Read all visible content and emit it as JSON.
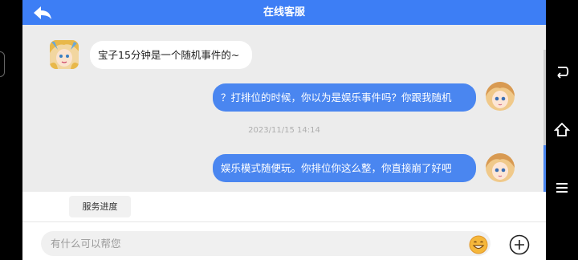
{
  "header": {
    "title": "在线客服"
  },
  "messages": {
    "incoming_1": "宝子15分钟是一个随机事件的~",
    "outgoing_1": "？打排位的时候，你以为是娱乐事件吗？你跟我随机",
    "timestamp": "2023/11/15 14:14",
    "outgoing_2": "娱乐模式随便玩。你排位你这么整，你直接崩了好吧"
  },
  "service_bar": {
    "chip_label": "服务进度"
  },
  "input_bar": {
    "placeholder": "有什么可以帮您"
  },
  "icons": {
    "back": "back-arrow-icon",
    "emoji": "smiley-icon",
    "add": "plus-circle-icon",
    "nav_back": "android-back-icon",
    "nav_home": "android-home-icon",
    "nav_menu": "android-menu-icon"
  },
  "colors": {
    "primary": "#3d7ef5",
    "bubble_out": "#4a86f0",
    "emoji": "#f5b73b"
  }
}
